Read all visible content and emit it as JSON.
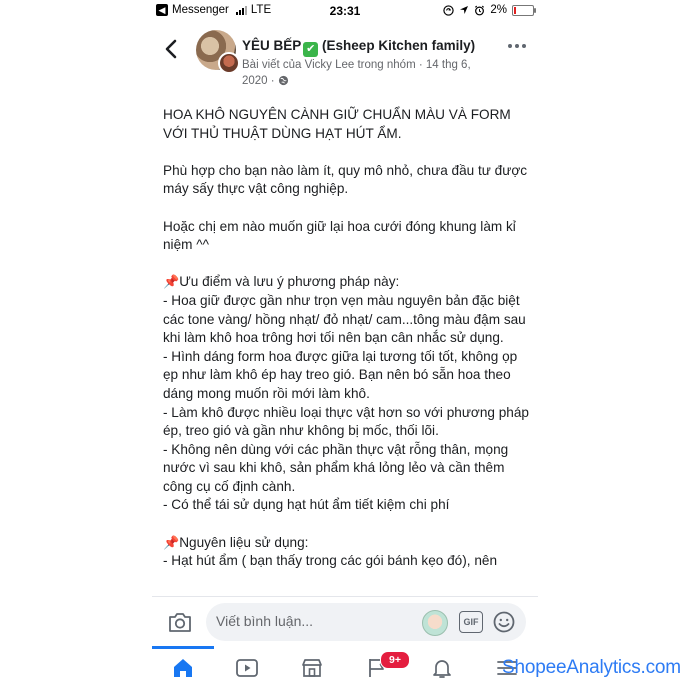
{
  "status_bar": {
    "carrier_app": "Messenger",
    "network": "LTE",
    "time": "23:31",
    "battery": "2%",
    "battery_level": 0.02
  },
  "header": {
    "group_name": "YÊU BẾP",
    "group_name_suffix": "(Esheep Kitchen family)",
    "post_meta": "Bài viết của Vicky Lee trong nhóm · 14 thg 6, 2020 ·"
  },
  "post": {
    "paragraphs": [
      "HOA KHÔ NGUYÊN CÀNH GIỮ CHUẨN MÀU VÀ FORM VỚI THỦ THUẬT DÙNG HẠT HÚT ẨM.",
      "Phù hợp cho bạn nào làm ít, quy mô nhỏ, chưa đầu tư được máy sấy thực vật công nghiệp.",
      "Hoặc chị em nào muốn giữ lại hoa cưới đóng khung làm kỉ niệm ^^"
    ],
    "section1_title": "Ưu điểm và lưu ý phương pháp này:",
    "section1_items": [
      "- Hoa giữ được gần như trọn vẹn màu nguyên bản đặc biệt các tone vàng/ hồng nhạt/ đỏ nhạt/ cam...tông màu đậm sau khi làm khô hoa trông hơi tối nên bạn cân nhắc sử dụng.",
      "- Hình dáng form hoa được giữa lại tương tối tốt, không ọp ẹp như làm khô ép hay treo gió. Bạn nên bó sẵn hoa theo dáng mong muốn rồi mới làm khô.",
      "- Làm khô được nhiều loại thực vật hơn so với phương pháp ép, treo gió và gần như không bị mốc, thối lõi.",
      "- Không nên dùng với các phần thực vật rỗng thân, mọng nước vì sau khi khô, sản phẩm khá lỏng lẻo và cần thêm công cụ cố định cành.",
      "- Có thể tái sử dụng hạt hút ẩm tiết kiệm chi phí"
    ],
    "section2_title": "Nguyên liệu sử dụng:",
    "section2_items": [
      "- Hạt hút ẩm ( bạn thấy trong các gói bánh kẹo đó), nên"
    ]
  },
  "comment_bar": {
    "placeholder": "Viết bình luận...",
    "gif_label": "GIF"
  },
  "tabbar": {
    "notification_badge": "9+"
  },
  "watermark": "ShopeeAnalytics.com",
  "colors": {
    "accent": "#1877f2",
    "badge": "#e41e3f",
    "check": "#3bb54a"
  }
}
